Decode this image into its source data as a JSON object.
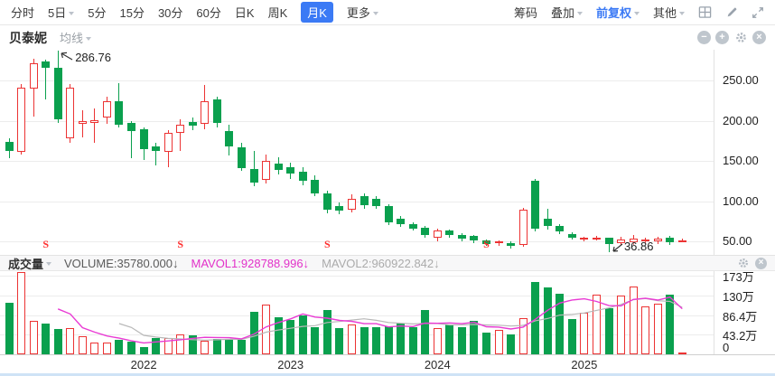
{
  "toolbar": {
    "periods": [
      {
        "label": "分时"
      },
      {
        "label": "5日",
        "caret": true
      },
      {
        "label": "5分"
      },
      {
        "label": "15分"
      },
      {
        "label": "30分"
      },
      {
        "label": "60分"
      },
      {
        "label": "日K"
      },
      {
        "label": "周K"
      },
      {
        "label": "月K",
        "active": true
      },
      {
        "label": "更多",
        "caret": true
      }
    ],
    "right_items": [
      {
        "label": "筹码"
      },
      {
        "label": "叠加",
        "caret": true
      },
      {
        "label": "前复权",
        "caret": true,
        "highlight": true
      },
      {
        "label": "其他",
        "caret": true
      }
    ],
    "icons": [
      "layout-grid-icon",
      "draw-icon",
      "fullscreen-icon"
    ]
  },
  "namebar": {
    "stock": "贝泰妮",
    "ma_label": "均线",
    "icons": [
      "zoom-out-icon",
      "zoom-in-icon",
      "settings-icon",
      "close-icon"
    ]
  },
  "volume_header": {
    "name": "成交量",
    "volume_label": "VOLUME:35780.000↓",
    "mavol1_label": "MAVOL1:928788.996↓",
    "mavol2_label": "MAVOL2:960922.842↓",
    "icons": [
      "settings-icon",
      "close-icon"
    ]
  },
  "colors": {
    "up": "#ec3333",
    "down": "#0aa04e",
    "accent_blue": "#3b7af5",
    "mavol1": "#e93bd4",
    "mavol2": "#b8b8b8",
    "signal": "#ff3030",
    "scrollbar": "#cfe3f6"
  },
  "chart_data": {
    "type": "candlestick",
    "title": "贝泰妮 月K 前复权",
    "start_month": "2021-03",
    "price_axis": {
      "tick_values": [
        250,
        200,
        150,
        100,
        50
      ],
      "tick_labels": [
        "250.00",
        "200.00",
        "150.00",
        "100.00",
        "50.00"
      ]
    },
    "volume_axis": {
      "tick_values_wan": [
        173,
        129.75,
        86.5,
        43.25,
        0
      ],
      "tick_labels": [
        "173万",
        "130万",
        "86.4万",
        "43.2万",
        "0"
      ]
    },
    "years": [
      "2022",
      "2023",
      "2024",
      "2025"
    ],
    "signal_label": "S",
    "signal_indices": [
      3,
      14,
      26,
      39
    ],
    "annotations": {
      "high": {
        "index": 4,
        "price": 286.76,
        "text": "286.76"
      },
      "low": {
        "index": 49,
        "price": 36.86,
        "text": "36.86"
      }
    },
    "mavol_periods": [
      5,
      10
    ],
    "candles": [
      [
        174,
        178,
        153,
        162,
        113
      ],
      [
        161,
        246,
        158,
        241,
        190
      ],
      [
        240,
        277,
        205,
        271,
        74
      ],
      [
        274,
        276,
        226,
        266,
        67
      ],
      [
        266,
        286.76,
        197,
        202,
        55
      ],
      [
        178,
        246,
        172,
        241,
        57
      ],
      [
        196,
        213,
        179,
        200,
        40
      ],
      [
        197,
        215,
        172,
        201,
        25
      ],
      [
        204,
        230,
        196,
        224,
        25
      ],
      [
        224,
        247,
        192,
        195,
        31
      ],
      [
        197,
        200,
        153,
        187,
        27
      ],
      [
        189,
        192,
        151,
        165,
        17
      ],
      [
        168,
        172,
        144,
        162,
        36
      ],
      [
        161,
        188,
        142,
        185,
        36
      ],
      [
        185,
        202,
        162,
        195,
        44
      ],
      [
        198,
        204,
        188,
        194,
        42
      ],
      [
        196,
        245,
        190,
        224,
        29
      ],
      [
        226,
        230,
        192,
        197,
        34
      ],
      [
        187,
        195,
        157,
        168,
        34
      ],
      [
        167,
        172,
        138,
        141,
        31
      ],
      [
        140,
        162,
        118,
        123,
        93
      ],
      [
        127,
        158,
        122,
        150,
        109
      ],
      [
        147,
        155,
        133,
        139,
        82
      ],
      [
        142,
        148,
        128,
        134,
        75
      ],
      [
        137,
        142,
        120,
        125,
        85
      ],
      [
        127,
        132,
        106,
        110,
        59
      ],
      [
        110,
        113,
        85,
        89,
        97
      ],
      [
        94,
        98,
        84,
        88,
        57
      ],
      [
        89,
        108,
        86,
        103,
        65
      ],
      [
        106,
        110,
        90,
        95,
        59
      ],
      [
        103,
        106,
        90,
        94,
        59
      ],
      [
        94,
        96,
        70,
        73,
        61
      ],
      [
        78,
        82,
        68,
        71,
        67
      ],
      [
        71,
        74,
        63,
        66,
        59
      ],
      [
        67,
        69,
        54,
        58,
        97
      ],
      [
        54,
        66,
        50,
        64,
        57
      ],
      [
        63,
        65,
        55,
        58,
        65
      ],
      [
        58,
        60,
        50,
        53,
        59
      ],
      [
        57,
        58,
        48,
        51,
        74
      ],
      [
        51,
        52,
        44,
        47,
        48
      ],
      [
        49,
        51,
        44,
        50,
        53
      ],
      [
        48,
        50,
        41,
        44,
        44
      ],
      [
        46,
        92,
        43,
        89,
        80
      ],
      [
        125,
        128,
        62,
        66,
        160
      ],
      [
        78,
        90,
        65,
        69,
        147
      ],
      [
        69,
        71,
        59,
        62,
        133
      ],
      [
        59,
        61,
        52,
        55,
        78
      ],
      [
        52,
        56,
        50,
        54,
        92
      ],
      [
        53,
        57,
        51,
        54,
        132
      ],
      [
        54,
        55,
        36.86,
        47,
        101
      ],
      [
        48,
        56,
        45,
        52,
        130
      ],
      [
        49,
        58,
        46,
        53,
        149
      ],
      [
        51,
        55,
        48,
        52,
        105
      ],
      [
        50,
        56,
        47,
        53,
        112
      ],
      [
        55,
        57,
        45,
        49,
        132
      ],
      [
        51,
        53,
        49,
        51.5,
        3.578
      ]
    ]
  }
}
